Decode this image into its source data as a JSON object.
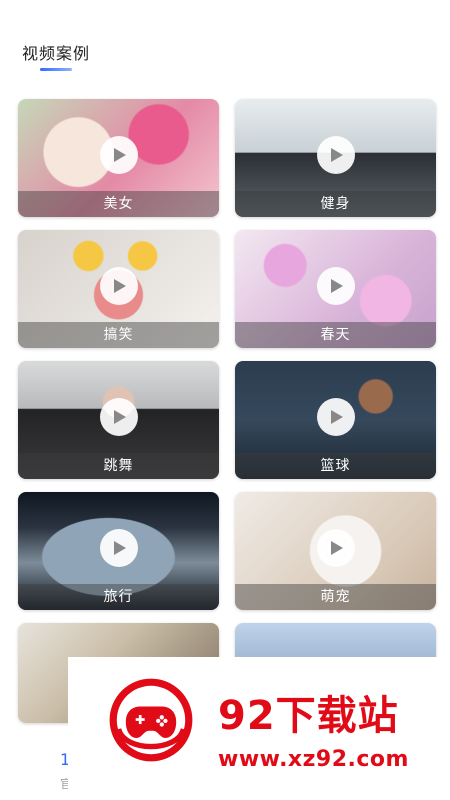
{
  "header": {
    "title": "视频案例"
  },
  "cards": [
    {
      "label": "美女",
      "bg": "bg-beauty"
    },
    {
      "label": "健身",
      "bg": "bg-fitness"
    },
    {
      "label": "搞笑",
      "bg": "bg-funny"
    },
    {
      "label": "春天",
      "bg": "bg-spring"
    },
    {
      "label": "跳舞",
      "bg": "bg-dance"
    },
    {
      "label": "篮球",
      "bg": "bg-basketball"
    },
    {
      "label": "旅行",
      "bg": "bg-travel"
    },
    {
      "label": "萌宠",
      "bg": "bg-pet"
    }
  ],
  "watermark": {
    "brand": "92下载站",
    "url": "www.xz92.com"
  },
  "bottom": {
    "char1": "1",
    "char2": "官"
  },
  "colors": {
    "accent": "#2f6bff",
    "watermark_red": "#e10a17"
  }
}
